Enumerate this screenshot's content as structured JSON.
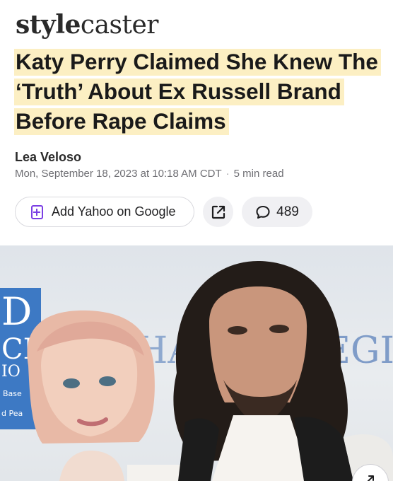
{
  "brand": {
    "logo_bold": "style",
    "logo_light": "caster"
  },
  "article": {
    "headline": "Katy Perry Claimed She Knew The ‘Truth’ About Ex Russell Brand Before Rape Claims",
    "author": "Lea Veloso",
    "date": "Mon, September 18, 2023 at 10:18 AM CDT",
    "separator": "·",
    "read_time": "5 min read"
  },
  "actions": {
    "add_google_label": "Add Yahoo on Google",
    "comment_count": "489"
  },
  "photo": {
    "backdrop_left_letters": "D",
    "backdrop_left_partial": "CH",
    "backdrop_left_small": "IO",
    "backdrop_left_tiny1": "Base",
    "backdrop_left_tiny2": "d Pea",
    "backdrop_center": "HA",
    "backdrop_right": "EGI"
  },
  "colors": {
    "highlight": "#fcefc3",
    "accent_purple": "#7b3fe4",
    "pill_bg": "#f0f0f3"
  }
}
